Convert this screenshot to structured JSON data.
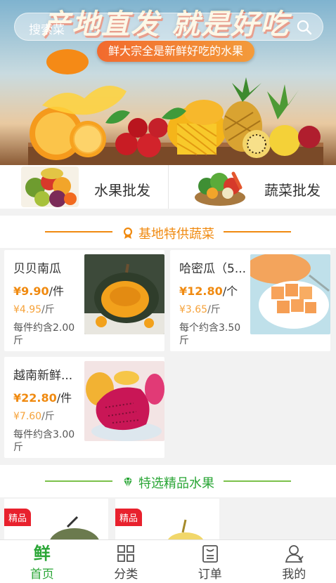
{
  "banner": {
    "headline": "产地直发 就是好吃",
    "subtitle": "鲜大宗全是新鲜好吃的水果",
    "search_placeholder": "搜索菜"
  },
  "categories": [
    {
      "label": "水果批发",
      "icon": "fruit-basket"
    },
    {
      "label": "蔬菜批发",
      "icon": "vegetable-basket"
    }
  ],
  "section_veg": {
    "title": "基地特供蔬菜",
    "icon": "ribbon-medal-icon",
    "accent": "#f08a10"
  },
  "products": [
    {
      "name": "贝贝南瓜",
      "price": "¥9.90",
      "unit": "/件",
      "unit_price": "¥4.95",
      "unit_price_unit": "/斤",
      "note": "每件约含2.00斤",
      "image": "pumpkin"
    },
    {
      "name": "哈密瓜（5...",
      "price": "¥12.80",
      "unit": "/个",
      "unit_price": "¥3.65",
      "unit_price_unit": "/斤",
      "note": "每个约含3.50斤",
      "image": "cantaloupe"
    },
    {
      "name": "越南新鲜...",
      "price": "¥22.80",
      "unit": "/件",
      "unit_price": "¥7.60",
      "unit_price_unit": "/斤",
      "note": "每件约含3.00斤",
      "image": "dragon-fruit"
    }
  ],
  "section_fruit": {
    "title": "特选精品水果",
    "icon": "gem-icon",
    "accent": "#2aa636"
  },
  "fruit_previews": [
    {
      "badge": "精品"
    },
    {
      "badge": "精品"
    }
  ],
  "tabbar": [
    {
      "label": "首页",
      "glyph": "鲜",
      "icon": "home-fresh-icon",
      "active": true
    },
    {
      "label": "分类",
      "icon": "grid-icon",
      "active": false
    },
    {
      "label": "订单",
      "icon": "order-icon",
      "active": false
    },
    {
      "label": "我的",
      "icon": "user-icon",
      "active": false
    }
  ],
  "colors": {
    "green": "#2aa636",
    "orange": "#f08a10",
    "red_badge": "#e8212d"
  }
}
